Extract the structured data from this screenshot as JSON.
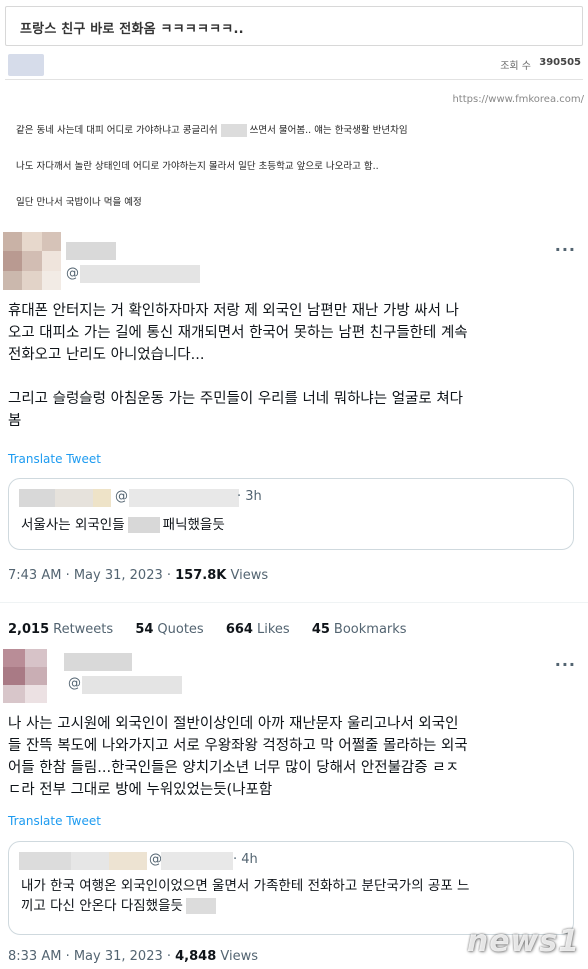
{
  "post": {
    "title": "프랑스 친구 바로 전화옴 ㅋㅋㅋㅋㅋㅋ..",
    "views_label": "조회 수",
    "views_value": "390505",
    "source_url": "https://www.fmkorea.com/",
    "body_lines": [
      "같은 동네 사는데 대피 어디로 가야하냐고 콩글리쉬",
      "쓰면서 물어봄.. 얘는 한국생활 반년차임",
      "나도 자다깨서 놀란 상태인데 어디로 가야하는지 몰라서 일단 초등학교 앞으로 나오라고 함..",
      "일단 만나서 국밥이나 먹을 예정"
    ]
  },
  "tweet1": {
    "handle_prefix": "@",
    "more_icon": "more-horizontal-icon",
    "text": "휴대폰 안터지는 거 확인하자마자 저랑 제 외국인 남편만 재난 가방 싸서 나\n오고 대피소 가는 길에 통신 재개되면서 한국어 못하는 남편 친구들한테 계속\n전화오고 난리도 아니었습니다...\n\n그리고 슬렁슬렁 아침운동 가는 주민들이 우리를 너네 뭐하냐는 얼굴로 쳐다\n봄",
    "translate": "Translate Tweet",
    "quote": {
      "at": "@",
      "time": "· 3h",
      "text_before": "서울사는 외국인들",
      "text_after": "패닉했을듯"
    },
    "time": "7:43 AM · May 31, 2023 · ",
    "views_num": "157.8K",
    "views_label": " Views",
    "stats": [
      {
        "num": "2,015",
        "label": "Retweets"
      },
      {
        "num": "54",
        "label": "Quotes"
      },
      {
        "num": "664",
        "label": "Likes"
      },
      {
        "num": "45",
        "label": "Bookmarks"
      }
    ]
  },
  "tweet2": {
    "handle_prefix": "@",
    "more_icon": "more-horizontal-icon",
    "text": "나 사는 고시원에 외국인이 절반이상인데 아까 재난문자 울리고나서 외국인\n들 잔뜩 복도에 나와가지고 서로 우왕좌왕 걱정하고 막 어쩔줄 몰라하는 외국\n어들 한참 들림...한국인들은 양치기소년 너무 많이 당해서 안전불감증 ㄹㅈ\nㄷ라 전부 그대로 방에 누워있었는듯(나포함",
    "translate": "Translate Tweet",
    "quote": {
      "at": "@",
      "time": "· 4h",
      "line1": "내가 한국 여행온 외국인이었으면 울면서 가족한테 전화하고 분단국가의 공포 느",
      "line2": "끼고 다신 안온다 다짐했을듯"
    },
    "time": "8:33 AM · May 31, 2023 · ",
    "views_num": "4,848",
    "views_label": " Views"
  },
  "watermark": "news1"
}
